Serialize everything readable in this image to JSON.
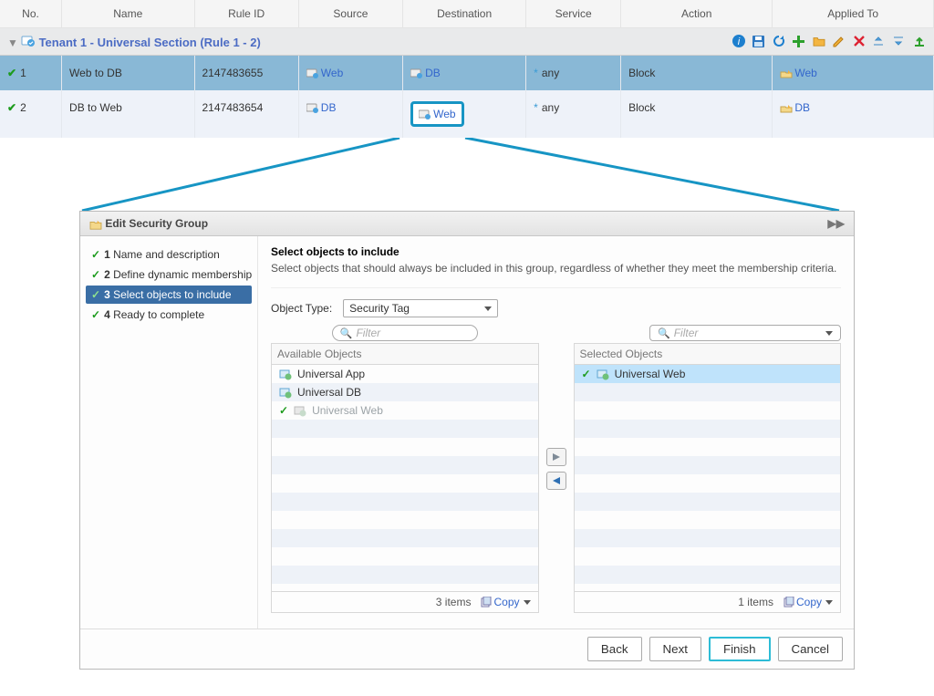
{
  "columns": [
    "No.",
    "Name",
    "Rule ID",
    "Source",
    "Destination",
    "Service",
    "Action",
    "Applied To"
  ],
  "section": {
    "title": "Tenant 1 - Universal Section (Rule 1 - 2)"
  },
  "rules": [
    {
      "no": "1",
      "name": "Web to DB",
      "rule_id": "2147483655",
      "source": "Web",
      "destination": "DB",
      "service": "any",
      "action": "Block",
      "applied_to": "Web"
    },
    {
      "no": "2",
      "name": "DB to Web",
      "rule_id": "2147483654",
      "source": "DB",
      "destination": "Web",
      "service": "any",
      "action": "Block",
      "applied_to": "DB"
    }
  ],
  "dialog": {
    "title": "Edit Security Group",
    "steps": [
      {
        "n": "1",
        "label": "Name and description"
      },
      {
        "n": "2",
        "label": "Define dynamic membership"
      },
      {
        "n": "3",
        "label": "Select objects to include"
      },
      {
        "n": "4",
        "label": "Ready to complete"
      }
    ],
    "heading": "Select objects to include",
    "sub": "Select objects that should always be included in this group, regardless of whether they meet the membership criteria.",
    "object_type_label": "Object Type:",
    "object_type_value": "Security Tag",
    "filter_placeholder": "Filter",
    "available_label": "Available Objects",
    "selected_label": "Selected Objects",
    "available": [
      {
        "label": "Universal App"
      },
      {
        "label": "Universal DB"
      },
      {
        "label": "Universal Web",
        "muted": true
      }
    ],
    "selected": [
      {
        "label": "Universal Web"
      }
    ],
    "avail_count": "3 items",
    "sel_count": "1 items",
    "copy_label": "Copy",
    "buttons": {
      "back": "Back",
      "next": "Next",
      "finish": "Finish",
      "cancel": "Cancel"
    }
  }
}
